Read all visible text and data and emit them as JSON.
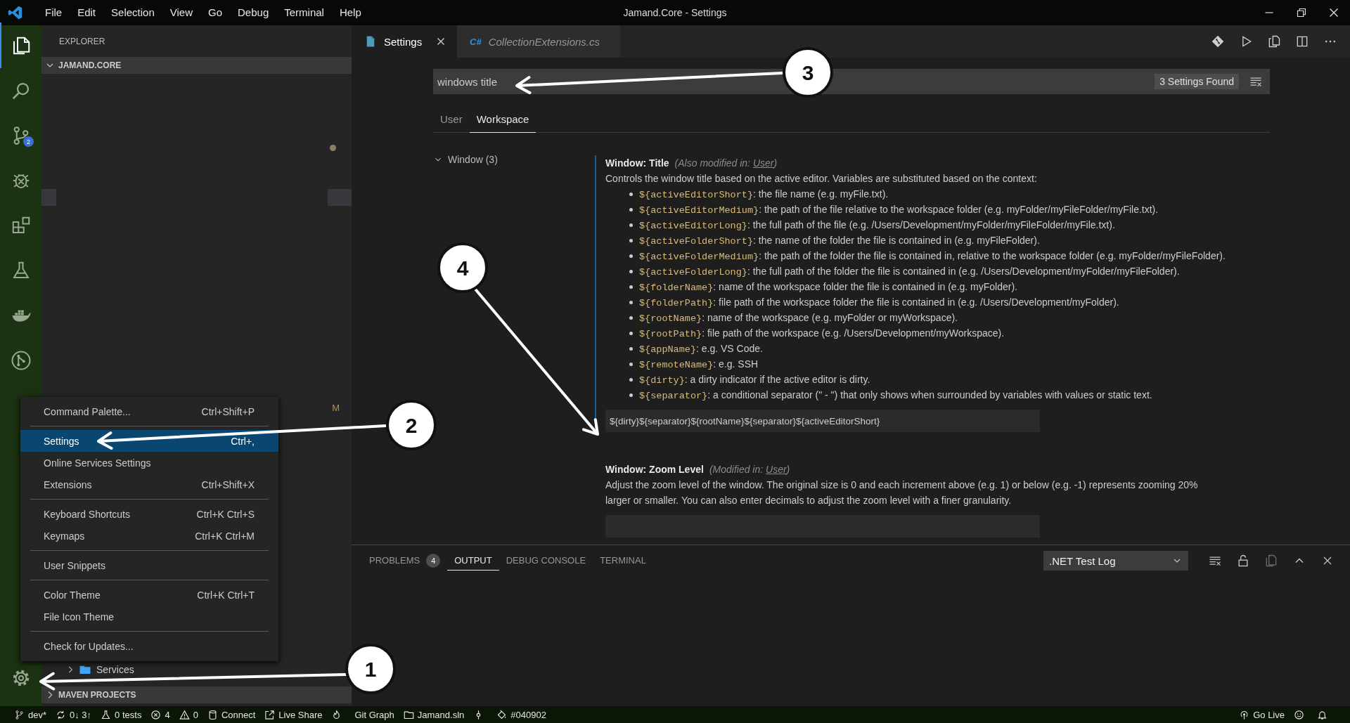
{
  "title_bar": {
    "menus": [
      "File",
      "Edit",
      "Selection",
      "View",
      "Go",
      "Debug",
      "Terminal",
      "Help"
    ],
    "title": "Jamand.Core - Settings"
  },
  "activity_bar": {
    "items": [
      {
        "kind": "files",
        "selected": true
      },
      {
        "kind": "search",
        "selected": false
      },
      {
        "kind": "source-control",
        "selected": false,
        "badge": "2"
      },
      {
        "kind": "debug",
        "selected": false
      },
      {
        "kind": "extensions",
        "selected": false
      },
      {
        "kind": "test",
        "selected": false
      },
      {
        "kind": "docker",
        "selected": false
      },
      {
        "kind": "git-graph",
        "selected": false
      }
    ]
  },
  "sidebar": {
    "title": "EXPLORER",
    "workspace": {
      "label": "JAMAND.CORE",
      "expanded": true
    },
    "git_status": "M",
    "folder": {
      "label": "Services",
      "expanded": false
    },
    "section": {
      "label": "MAVEN PROJECTS",
      "expanded": false
    }
  },
  "editor_tabs": [
    {
      "label": "Settings",
      "kind": "settings",
      "selected": true,
      "preview": false
    },
    {
      "label": "CollectionExtensions.cs",
      "kind": "csharp",
      "icon_text": "C#",
      "selected": false,
      "preview": true
    }
  ],
  "settings": {
    "search": {
      "value": "windows title",
      "result_count": "3 Settings Found"
    },
    "scope_tabs": [
      {
        "label": "User",
        "selected": false
      },
      {
        "label": "Workspace",
        "selected": true
      }
    ],
    "tree": [
      {
        "label": "Window (3)",
        "expanded": true
      }
    ],
    "items": [
      {
        "title": "Window: **Title**",
        "modified": true,
        "note_before": "(Also modified in: ",
        "note_link": "User",
        "note_after": ")",
        "description": "Controls the window title based on the active editor. Variables are substituted based on the context:",
        "variables": [
          {
            "code": "${activeEditorShort}",
            "text": ": the file name (e.g. myFile.txt)."
          },
          {
            "code": "${activeEditorMedium}",
            "text": ": the path of the file relative to the workspace folder (e.g. myFolder/myFileFolder/myFile.txt)."
          },
          {
            "code": "${activeEditorLong}",
            "text": ": the full path of the file (e.g. /Users/Development/myFolder/myFileFolder/myFile.txt)."
          },
          {
            "code": "${activeFolderShort}",
            "text": ": the name of the folder the file is contained in (e.g. myFileFolder)."
          },
          {
            "code": "${activeFolderMedium}",
            "text": ": the path of the folder the file is contained in, relative to the workspace folder (e.g. myFolder/myFileFolder)."
          },
          {
            "code": "${activeFolderLong}",
            "text": ": the full path of the folder the file is contained in (e.g. /Users/Development/myFolder/myFileFolder)."
          },
          {
            "code": "${folderName}",
            "text": ": name of the workspace folder the file is contained in (e.g. myFolder)."
          },
          {
            "code": "${folderPath}",
            "text": ": file path of the workspace folder the file is contained in (e.g. /Users/Development/myFolder)."
          },
          {
            "code": "${rootName}",
            "text": ": name of the workspace (e.g. myFolder or myWorkspace)."
          },
          {
            "code": "${rootPath}",
            "text": ": file path of the workspace (e.g. /Users/Development/myWorkspace)."
          },
          {
            "code": "${appName}",
            "text": ": e.g. VS Code."
          },
          {
            "code": "${remoteName}",
            "text": ": e.g. SSH"
          },
          {
            "code": "${dirty}",
            "text": ": a dirty indicator if the active editor is dirty."
          },
          {
            "code": "${separator}",
            "text": ": a conditional separator (\" - \") that only shows when surrounded by variables with values or static text."
          }
        ],
        "value": "${dirty}${separator}${rootName}${separator}${activeEditorShort}"
      },
      {
        "title": "Window: **Zoom Level**",
        "modified": false,
        "note_before": "(Modified in: ",
        "note_link": "User",
        "note_after": ")",
        "description": "Adjust the zoom level of the window. The original size is 0 and each increment above (e.g. 1) or below (e.g. -1) represents zooming 20% larger or smaller. You can also enter decimals to adjust the zoom level with a finer granularity."
      }
    ]
  },
  "panel": {
    "tabs": [
      {
        "label": "PROBLEMS",
        "badge": "4",
        "selected": false
      },
      {
        "label": "OUTPUT",
        "selected": true
      },
      {
        "label": "DEBUG CONSOLE",
        "selected": false
      },
      {
        "label": "TERMINAL",
        "selected": false
      }
    ],
    "output_channel": ".NET Test Log"
  },
  "context_menu": {
    "groups": [
      [
        {
          "label": "Command Palette...",
          "shortcut": "Ctrl+Shift+P",
          "selected": false
        }
      ],
      [
        {
          "label": "Settings",
          "shortcut": "Ctrl+,",
          "selected": true
        },
        {
          "label": "Online Services Settings",
          "selected": false
        },
        {
          "label": "Extensions",
          "shortcut": "Ctrl+Shift+X",
          "selected": false
        }
      ],
      [
        {
          "label": "Keyboard Shortcuts",
          "shortcut": "Ctrl+K Ctrl+S",
          "selected": false
        },
        {
          "label": "Keymaps",
          "shortcut": "Ctrl+K Ctrl+M",
          "selected": false
        }
      ],
      [
        {
          "label": "User Snippets",
          "selected": false
        }
      ],
      [
        {
          "label": "Color Theme",
          "shortcut": "Ctrl+K Ctrl+T",
          "selected": false
        },
        {
          "label": "File Icon Theme",
          "selected": false
        }
      ],
      [
        {
          "label": "Check for Updates...",
          "selected": false
        }
      ]
    ]
  },
  "status_bar": {
    "left": [
      {
        "kind": "branch",
        "text": "dev*"
      },
      {
        "kind": "sync",
        "text": "0↓ 3↑"
      },
      {
        "kind": "tests",
        "text": "0 tests"
      },
      {
        "kind": "errors",
        "text": "4"
      },
      {
        "kind": "warnings",
        "text": "0"
      },
      {
        "kind": "database",
        "text": "Connect"
      },
      {
        "kind": "live-share",
        "text": "Live Share"
      },
      {
        "kind": "flame"
      },
      {
        "kind": "plain",
        "text": "Git Graph"
      },
      {
        "kind": "folder",
        "text": "Jamand.sln"
      },
      {
        "kind": "pin"
      },
      {
        "kind": "paint",
        "text": "#040902"
      }
    ],
    "right": [
      {
        "kind": "broadcast",
        "text": "Go Live"
      },
      {
        "kind": "smiley"
      },
      {
        "kind": "bell"
      }
    ]
  },
  "annotations": [
    {
      "label": "1"
    },
    {
      "label": "2"
    },
    {
      "label": "3"
    },
    {
      "label": "4"
    }
  ]
}
